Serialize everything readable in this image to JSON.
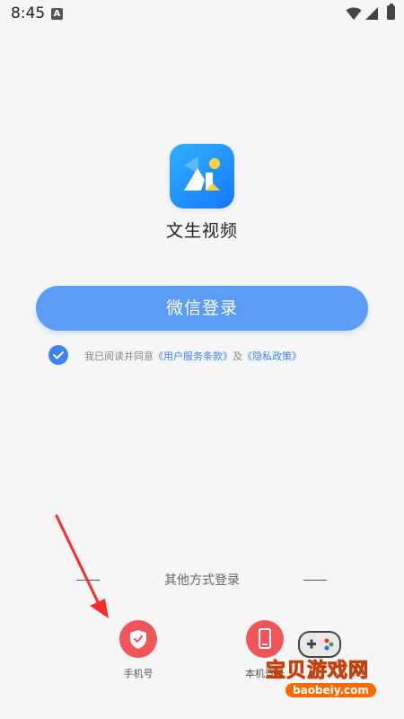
{
  "status_bar": {
    "time": "8:45",
    "notification_icon": "A"
  },
  "app": {
    "name": "文生视频",
    "logo_icon": "app-logo-ai"
  },
  "login": {
    "wechat_button": "微信登录"
  },
  "agreement": {
    "prefix": "我已阅读并同意",
    "terms_link": "《用户服务条款》",
    "conjunction": "及",
    "privacy_link": "《隐私政策》",
    "checked": true
  },
  "other_methods": {
    "title": "其他方式登录",
    "options": [
      {
        "label": "手机号",
        "icon": "shield-check-icon"
      },
      {
        "label": "本机登录",
        "icon": "mobile-phone-icon"
      }
    ]
  },
  "watermark": {
    "title": "宝贝游戏网",
    "url": "baobeiy.com"
  },
  "colors": {
    "accent": "#5b9cf7",
    "link": "#3f83f1",
    "option_red": "#f0555a"
  }
}
